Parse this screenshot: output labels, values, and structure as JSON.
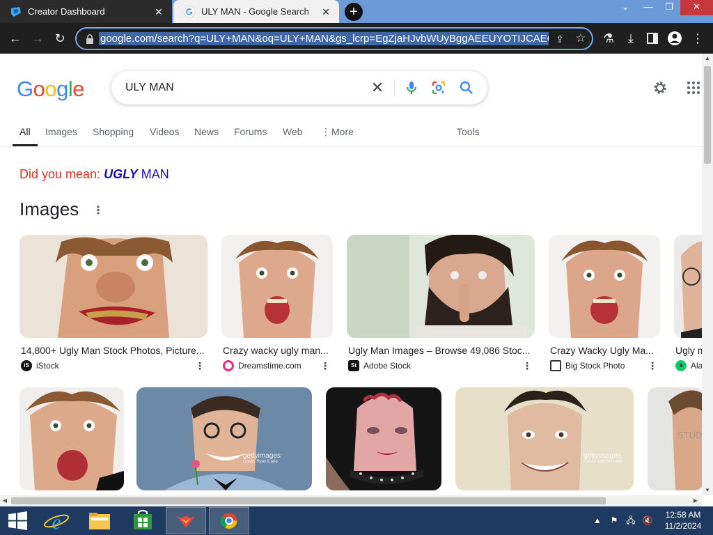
{
  "tabs": [
    {
      "title": "Creator Dashboard",
      "active": false,
      "favicon": "creator-icon"
    },
    {
      "title": "ULY MAN - Google Search",
      "active": true,
      "favicon": "google-g-icon"
    }
  ],
  "toolbar": {
    "url": "google.com/search?q=ULY+MAN&oq=ULY+MAN&gs_lcrp=EgZjaHJvbWUyBggAEEUYOTIJCAEQABgKGIA"
  },
  "google": {
    "logo": "Google",
    "query": "ULY MAN",
    "nav": [
      "All",
      "Images",
      "Shopping",
      "Videos",
      "News",
      "Forums",
      "Web",
      "More",
      "Tools"
    ],
    "did_you_mean": {
      "label": "Did you mean:",
      "bold": "UGLY",
      "rest": "MAN"
    },
    "images_heading": "Images"
  },
  "image_results": [
    {
      "title": "14,800+ Ugly Man Stock Photos, Picture...",
      "source": "iStock",
      "source_icon": "istock-icon"
    },
    {
      "title": "Crazy wacky ugly man...",
      "source": "Dreamstime.com",
      "source_icon": "dreamstime-icon"
    },
    {
      "title": "Ugly Man Images – Browse 49,086 Stoc...",
      "source": "Adobe Stock",
      "source_icon": "adobe-stock-icon"
    },
    {
      "title": "Crazy Wacky Ugly Ma...",
      "source": "Big Stock Photo",
      "source_icon": "bigstock-icon"
    },
    {
      "title": "Ugly m",
      "source": "Ala",
      "source_icon": "alamy-icon"
    }
  ],
  "watermarks": {
    "gettyimages": "gettyimages",
    "credit_ryan": "Credit: RyanJLane",
    "credit_john": "Credit: John Rensten",
    "stud": "STUD"
  },
  "taskbar": {
    "time": "12:58 AM",
    "date": "11/2/2024"
  },
  "colors": {
    "tabstrip": "#6b9ad9",
    "google_blue": "#4285f4",
    "google_red": "#ea4335",
    "google_yellow": "#fbbc05",
    "google_green": "#34a853",
    "link": "#1a0dab",
    "did_you_mean": "#d93025"
  }
}
